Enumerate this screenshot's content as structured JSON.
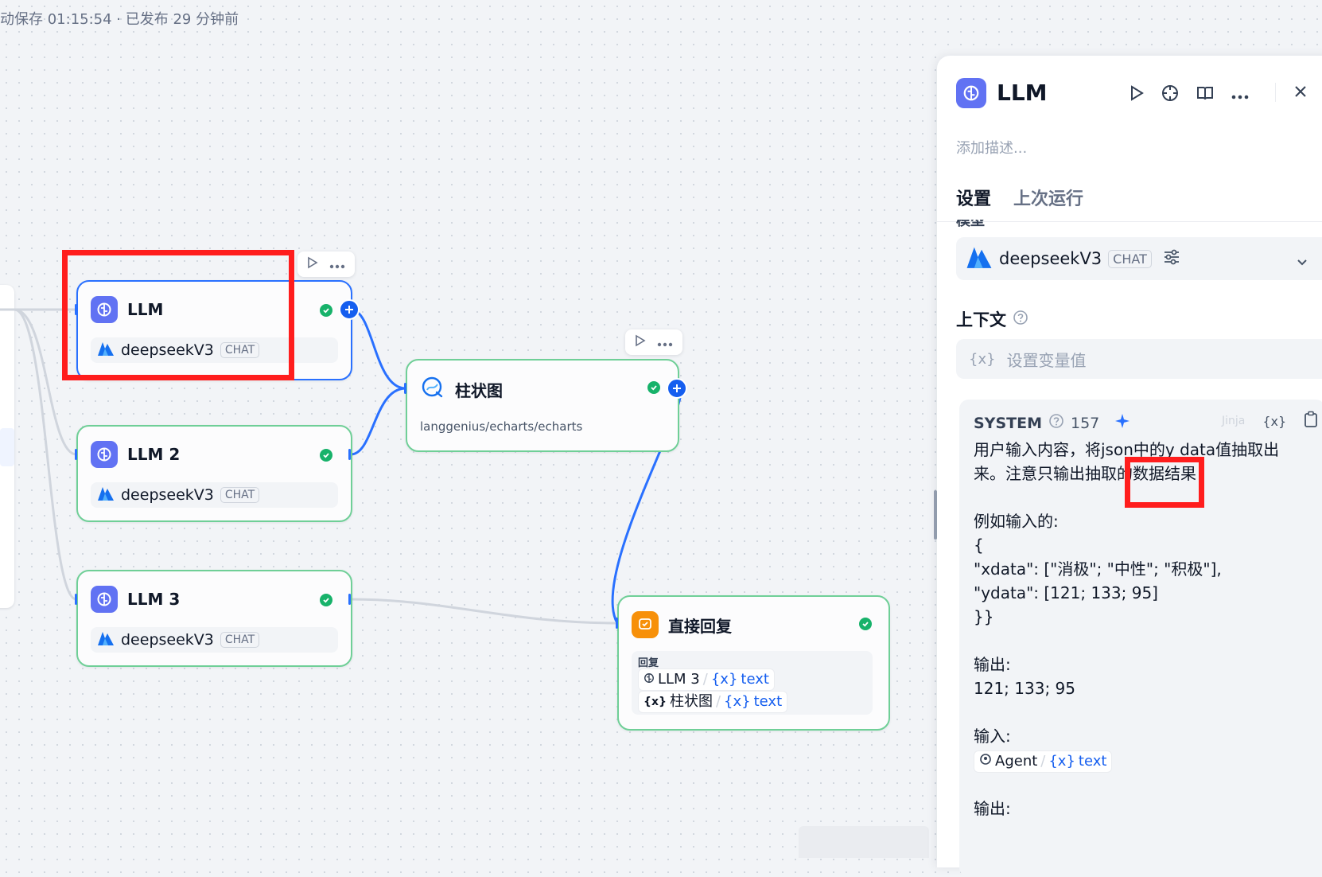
{
  "topbar": {
    "status": "动保存 01:15:54 · 已发布 29 分钟前"
  },
  "nodes": {
    "llm1": {
      "title": "LLM",
      "model": "deepseekV3",
      "mode": "CHAT"
    },
    "llm2": {
      "title": "LLM 2",
      "model": "deepseekV3",
      "mode": "CHAT"
    },
    "llm3": {
      "title": "LLM 3",
      "model": "deepseekV3",
      "mode": "CHAT"
    },
    "chart": {
      "title": "柱状图",
      "subtitle": "langgenius/echarts/echarts"
    },
    "reply": {
      "title": "直接回复",
      "section_label": "回复",
      "vars": [
        {
          "source": "LLM 3",
          "sep": "/",
          "var": "text"
        },
        {
          "source": "柱状图",
          "sep": "/",
          "var": "text"
        }
      ]
    }
  },
  "panel": {
    "title": "LLM",
    "description_placeholder": "添加描述...",
    "tabs": [
      {
        "label": "设置"
      },
      {
        "label": "上次运行"
      }
    ],
    "model_section_label": "模型",
    "model": {
      "name": "deepseekV3",
      "mode": "CHAT"
    },
    "context": {
      "label": "上下文",
      "placeholder": "设置变量值"
    },
    "prompt": {
      "role": "SYSTEM",
      "token_count": "157",
      "hidden_text": "Jinja",
      "line1": "用户输入内容，将json中的y data值抽取出",
      "line2": "来。注意只输出抽取的数据结果",
      "example_label": "例如输入的:",
      "json_open": "{",
      "json_x": "\"xdata\": [\"消极\"; \"中性\"; \"积极\"],",
      "json_y": "\"ydata\": [121; 133; 95]",
      "json_close": "}}",
      "output_label1": "输出:",
      "output_value1": "121; 133; 95",
      "input_label": "输入:",
      "input_chip_source": "Agent",
      "input_chip_sep": "/",
      "input_chip_var": "text",
      "output_label2": "输出:"
    }
  },
  "colors": {
    "accent": "#155eef",
    "node_border": "#6fcf97",
    "selected_border": "#2970ff",
    "llm_icon": "#6172f3",
    "reply_icon": "#f79009",
    "highlight": "#ff1d1d"
  }
}
